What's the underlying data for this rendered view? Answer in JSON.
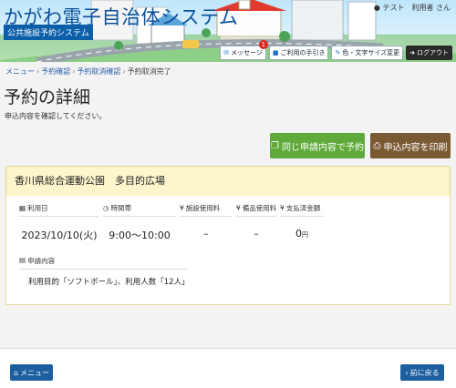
{
  "header": {
    "site_title": "かがわ電子自治体システム",
    "site_subtitle": "公共施設予約システム",
    "user_icon": "user-icon",
    "user_name": "テスト　利用者 さん",
    "toolbar": {
      "message_label": "メッセージ",
      "message_badge": "1",
      "guide_label": "ご利用の手引き",
      "display_label": "色・文字サイズ変更",
      "logout_label": "ログアウト"
    }
  },
  "breadcrumb": {
    "items": [
      "メニュー",
      "予約確認",
      "予約取消確認"
    ],
    "separator": "›",
    "current": "予約取消完了"
  },
  "page": {
    "title": "予約の詳細",
    "hint": "申込内容を確認してください。"
  },
  "actions": {
    "same_reserve_label": "同じ申請内容で予約",
    "print_label": "申込内容を印刷"
  },
  "reservation": {
    "facility": "香川県総合運動公園　多目的広場",
    "use_date_label": "利用日",
    "use_date": "2023/10/10(火)",
    "time_label": "時間帯",
    "time": "9:00～10:00",
    "facility_fee_label": "施設使用料",
    "facility_fee": "–",
    "equipment_fee_label": "備品使用料",
    "equipment_fee": "–",
    "paid_label": "支払済金額",
    "paid_amount": "0",
    "paid_unit": "円",
    "application_label": "申請内容",
    "application_value": "利用目的「ソフトボール」、利用人数「12人」"
  },
  "footer": {
    "menu_label": "メニュー",
    "back_label": "前に戻る"
  },
  "colors": {
    "primary": "#1d5e9e",
    "green": "#5faa3a",
    "brown": "#7a5a33",
    "card_header": "#fdf6cc"
  }
}
